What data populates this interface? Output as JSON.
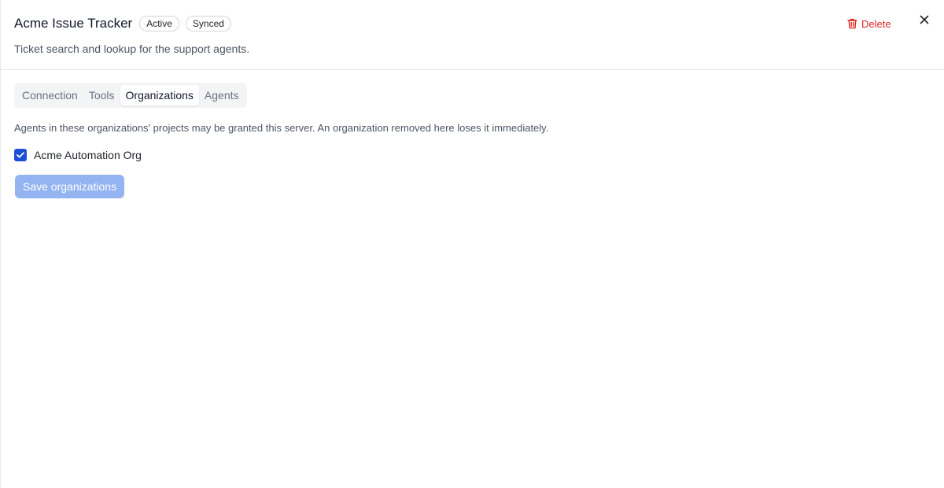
{
  "header": {
    "title": "Acme Issue Tracker",
    "badges": [
      "Active",
      "Synced"
    ],
    "subtitle": "Ticket search and lookup for the support agents.",
    "delete_label": "Delete",
    "delete_icon": "trash-icon",
    "close_icon": "close-icon"
  },
  "tabs": [
    {
      "label": "Connection",
      "active": false
    },
    {
      "label": "Tools",
      "active": false
    },
    {
      "label": "Organizations",
      "active": true
    },
    {
      "label": "Agents",
      "active": false
    }
  ],
  "organizations": {
    "description": "Agents in these organizations' projects may be granted this server. An organization removed here loses it immediately.",
    "items": [
      {
        "label": "Acme Automation Org",
        "checked": true
      }
    ],
    "save_label": "Save organizations",
    "save_disabled": true
  },
  "colors": {
    "accent": "#1d4ed8",
    "danger": "#dc2626",
    "disabled_button": "#93b4f0"
  }
}
